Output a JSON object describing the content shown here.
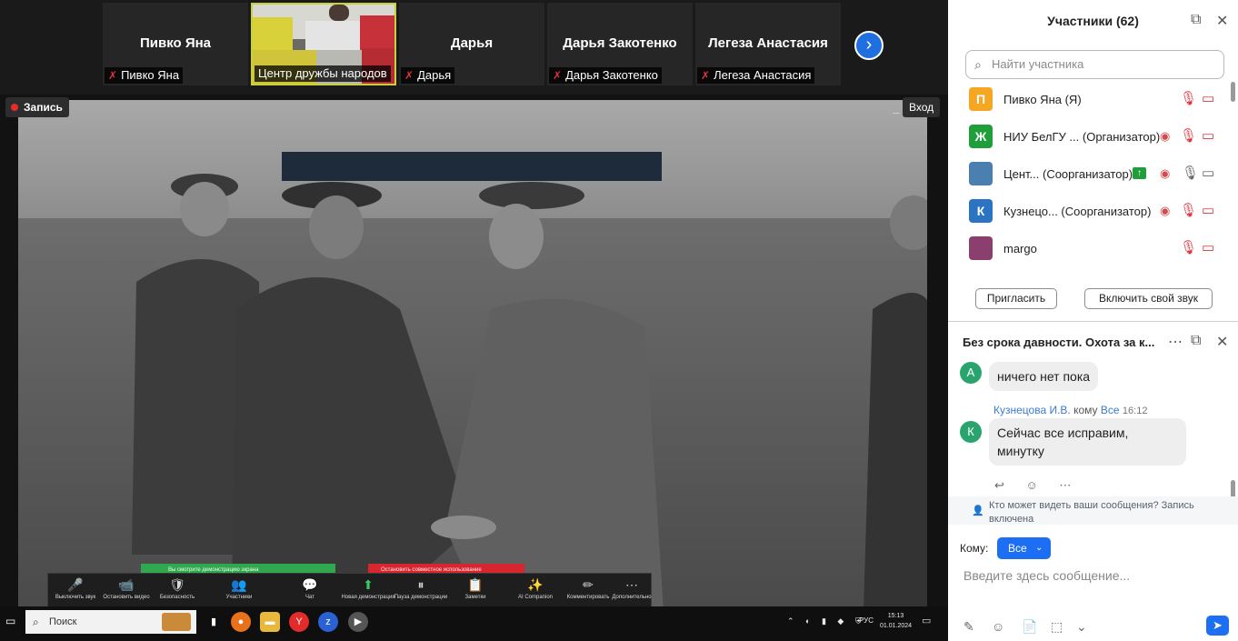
{
  "strip": {
    "tiles": [
      {
        "name": "Пивко Яна",
        "label": "Пивко Яна"
      },
      {
        "name": "",
        "label": "Центр дружбы народов"
      },
      {
        "name": "Дарья",
        "label": "Дарья"
      },
      {
        "name": "Дарья Закотенко",
        "label": "Дарья Закотенко"
      },
      {
        "name": "Легеза Анастасия",
        "label": "Легеза Анастасия"
      }
    ],
    "mute_glyph": "✗",
    "next_glyph": "›"
  },
  "share": {
    "recording_label": "Запись",
    "enter_label": "Вход",
    "minimize_glyph": "–",
    "green_notice": "Вы смотрите демонстрацию экрана",
    "red_notice": "Остановить совместное использование",
    "inner_toolbar": [
      {
        "icon": "🎤",
        "label": "Выключить звук"
      },
      {
        "icon": "📹",
        "label": "Остановить видео"
      },
      {
        "icon": "🛡",
        "label": "Безопасность"
      },
      {
        "icon": "👥",
        "label": "Участники"
      },
      {
        "icon": "💬",
        "label": "Чат"
      },
      {
        "icon": "⬆",
        "label": "Новая демонстрация"
      },
      {
        "icon": "⏸",
        "label": "Пауза демонстрации"
      },
      {
        "icon": "📋",
        "label": "Заметки"
      },
      {
        "icon": "✨",
        "label": "AI Companion"
      },
      {
        "icon": "✏",
        "label": "Комментировать"
      },
      {
        "icon": "⋯",
        "label": "Дополнительно"
      }
    ]
  },
  "taskbar": {
    "start_glyph": "▭",
    "search_placeholder": "Поиск",
    "language": "РУС",
    "time": "15:13",
    "date": "01.01.2024"
  },
  "participants": {
    "title": "Участники (62)",
    "search_placeholder": "Найти участника",
    "rows": [
      {
        "avatar_text": "П",
        "avatar_color": "#f5a623",
        "name": "Пивко Яна (Я)",
        "rec": false,
        "mic": "muted",
        "cam": "muted"
      },
      {
        "avatar_text": "Ж",
        "avatar_color": "#1f9e3a",
        "name": "НИУ БелГУ ... (Организатор)",
        "rec": true,
        "mic": "muted",
        "cam": "muted"
      },
      {
        "avatar_text": "",
        "avatar_color": "#4a7fb0",
        "name": "Цент... (Соорганизатор)",
        "rec": true,
        "mic": "on",
        "cam": "on",
        "share_badge": true
      },
      {
        "avatar_text": "К",
        "avatar_color": "#2a74c2",
        "name": "Кузнецо... (Соорганизатор)",
        "rec": true,
        "mic": "muted",
        "cam": "muted"
      },
      {
        "avatar_text": "",
        "avatar_color": "#8a3f6e",
        "name": "margo",
        "rec": false,
        "mic": "muted",
        "cam": "muted"
      }
    ],
    "invite_label": "Пригласить",
    "unmute_label": "Включить свой звук",
    "popout_glyph": "⧉",
    "close_glyph": "✕"
  },
  "chat": {
    "title": "Без срока давности. Охота за к...",
    "more_glyph": "⋯",
    "popout_glyph": "⧉",
    "close_glyph": "✕",
    "messages": [
      {
        "avatar": "А",
        "text": "ничего нет пока"
      },
      {
        "avatar": "К",
        "sender": "Кузнецова И.В.",
        "to_word": "кому",
        "to": "Все",
        "time": "16:12",
        "text": "Сейчас все исправим, минутку"
      }
    ],
    "message_actions": "↩ ☺ ⋯",
    "visibility_note": "Кто может видеть ваши сообщения? Запись включена",
    "to_label": "Кому:",
    "to_value": "Все",
    "input_placeholder": "Введите здесь сообщение...",
    "bottom_icons": [
      "✎",
      "☺",
      "📄",
      "⬚",
      "⌄"
    ],
    "send_glyph": "➤"
  }
}
